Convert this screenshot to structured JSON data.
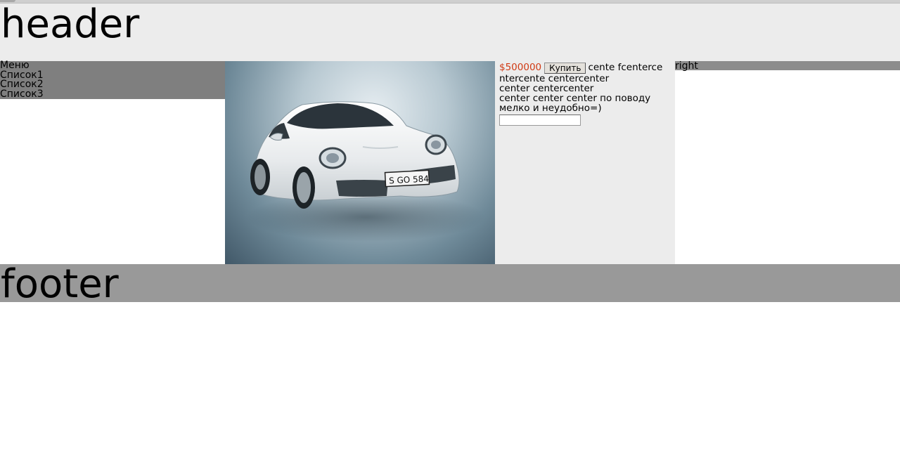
{
  "header": {
    "title": "header"
  },
  "menu": {
    "title": "Меню",
    "items": [
      "Список1",
      "Список2",
      "Список3"
    ]
  },
  "product": {
    "price": "$500000",
    "buy_label": "Купить",
    "desc_line1": "cente fcenterce",
    "desc_line2": "ntercente centercenter",
    "desc_line3": "center centercenter",
    "desc_line4": "center center center по поводу",
    "desc_line5": "мелко и неудобно=)",
    "input_value": ""
  },
  "right": {
    "title": "right"
  },
  "footer": {
    "title": "footer"
  },
  "photo": {
    "plate_text": "S GO 584"
  }
}
